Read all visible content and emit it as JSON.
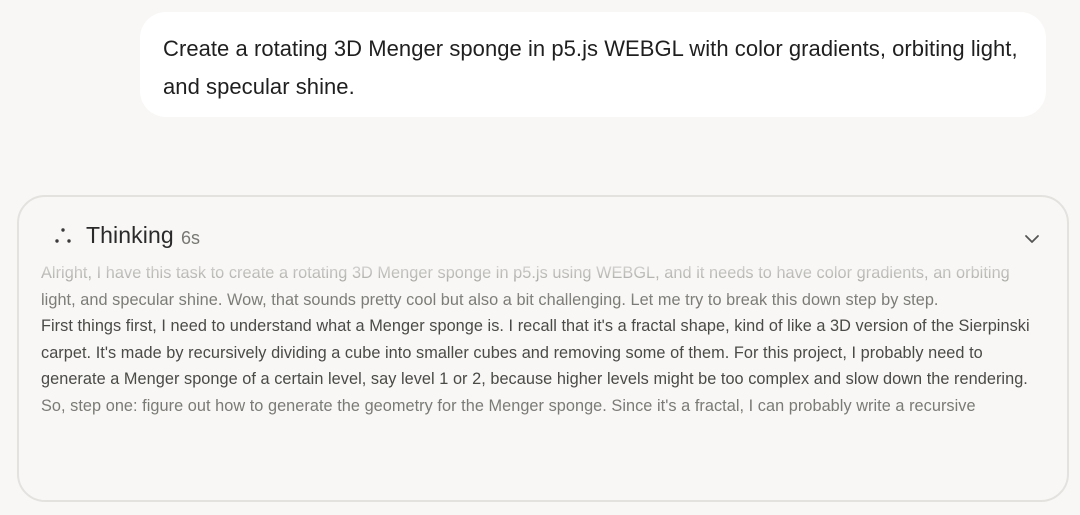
{
  "user_message": {
    "text": "Create a rotating 3D Menger sponge in p5.js WEBGL with color gradients, orbiting light, and specular shine."
  },
  "thinking": {
    "label": "Thinking",
    "duration": "6s",
    "icon": "dots-triangle-icon",
    "collapse_icon": "chevron-down-icon",
    "paragraphs": [
      "Alright, I have this task to create a rotating 3D Menger sponge in p5.js using WEBGL, and it needs to have color gradients, an orbiting light, and specular shine. Wow, that sounds pretty cool but also a bit challenging. Let me try to break this down step by step.",
      "First things first, I need to understand what a Menger sponge is. I recall that it's a fractal shape, kind of like a 3D version of the Sierpinski carpet. It's made by recursively dividing a cube into smaller cubes and removing some of them. For this project, I probably need to generate a Menger sponge of a certain level, say level 1 or 2, because higher levels might be too complex and slow down the rendering.",
      "So, step one: figure out how to generate the geometry for the Menger sponge. Since it's a fractal, I can probably write a recursive"
    ]
  }
}
